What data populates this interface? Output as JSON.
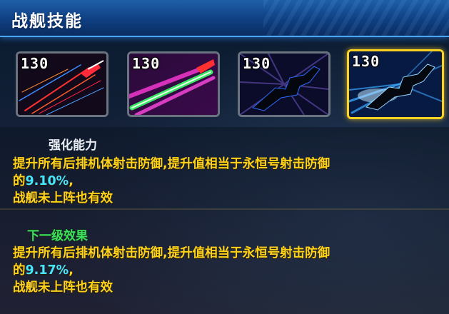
{
  "header": {
    "title": "战舰技能"
  },
  "skills": [
    {
      "level": "130",
      "icon": "missile-barrage-skill-icon",
      "selected": false
    },
    {
      "level": "130",
      "icon": "laser-beam-skill-icon",
      "selected": false
    },
    {
      "level": "130",
      "icon": "warship-silhouette-skill-icon",
      "selected": false
    },
    {
      "level": "130",
      "icon": "warship-boost-skill-icon",
      "selected": true
    }
  ],
  "current": {
    "title": "强化能力",
    "line1": "提升所有后排机体射击防御,提升值相当于永恒号射击防御",
    "line2_prefix": "的",
    "line2_value": "9.10%",
    "line2_suffix": ",",
    "line3": "战舰未上阵也有效"
  },
  "next": {
    "title": "下一级效果",
    "line1": "提升所有后排机体射击防御,提升值相当于永恒号射击防御",
    "line2_prefix": "的",
    "line2_value": "9.17%",
    "line2_suffix": ",",
    "line3": "战舰未上阵也有效"
  },
  "colors": {
    "accent_gold": "#ffd21a",
    "value_cyan": "#47e6ff",
    "next_green": "#3fe05a",
    "header_blue": "#1f5fa8"
  }
}
